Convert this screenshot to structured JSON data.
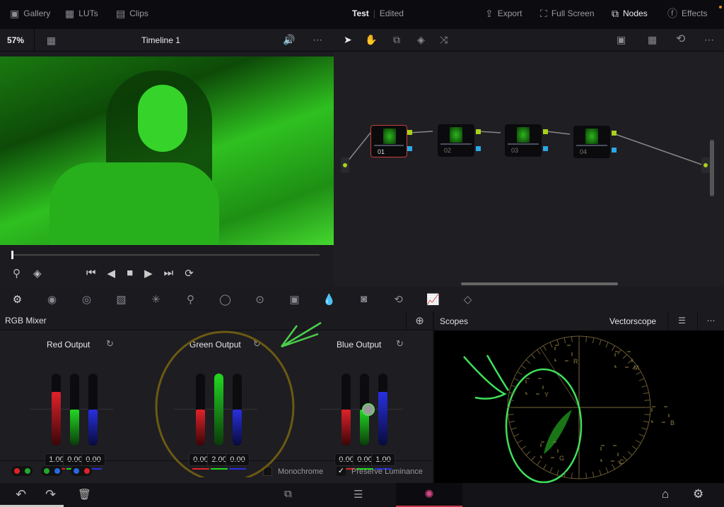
{
  "topbar": {
    "gallery": "Gallery",
    "luts": "LUTs",
    "clips": "Clips",
    "project": "Test",
    "status": "Edited",
    "export": "Export",
    "fullscreen": "Full Screen",
    "nodes": "Nodes",
    "effects": "Effects"
  },
  "toolbar": {
    "zoom": "57%",
    "timeline": "Timeline 1"
  },
  "nodes": [
    {
      "label": "01",
      "selected": true
    },
    {
      "label": "02"
    },
    {
      "label": "03"
    },
    {
      "label": "04"
    }
  ],
  "mixer": {
    "title": "RGB Mixer",
    "groups": [
      {
        "title": "Red Output",
        "values": [
          "1.00",
          "0.00",
          "0.00"
        ]
      },
      {
        "title": "Green Output",
        "values": [
          "0.00",
          "2.00",
          "0.00"
        ]
      },
      {
        "title": "Blue Output",
        "values": [
          "0.00",
          "0.00",
          "1.00"
        ]
      }
    ],
    "monochrome": "Monochrome",
    "monochrome_checked": false,
    "preserve": "Preserve Luminance",
    "preserve_checked": true
  },
  "scopes": {
    "title": "Scopes",
    "mode": "Vectorscope",
    "targets": [
      "R",
      "M",
      "Y",
      "B",
      "G",
      "C"
    ]
  },
  "colors": {
    "red": "#e0222a",
    "green": "#22d822",
    "blue": "#2830e0",
    "accent": "#a8d21a",
    "cyan": "#2aa8e8",
    "annotation": "#3fe05a"
  }
}
